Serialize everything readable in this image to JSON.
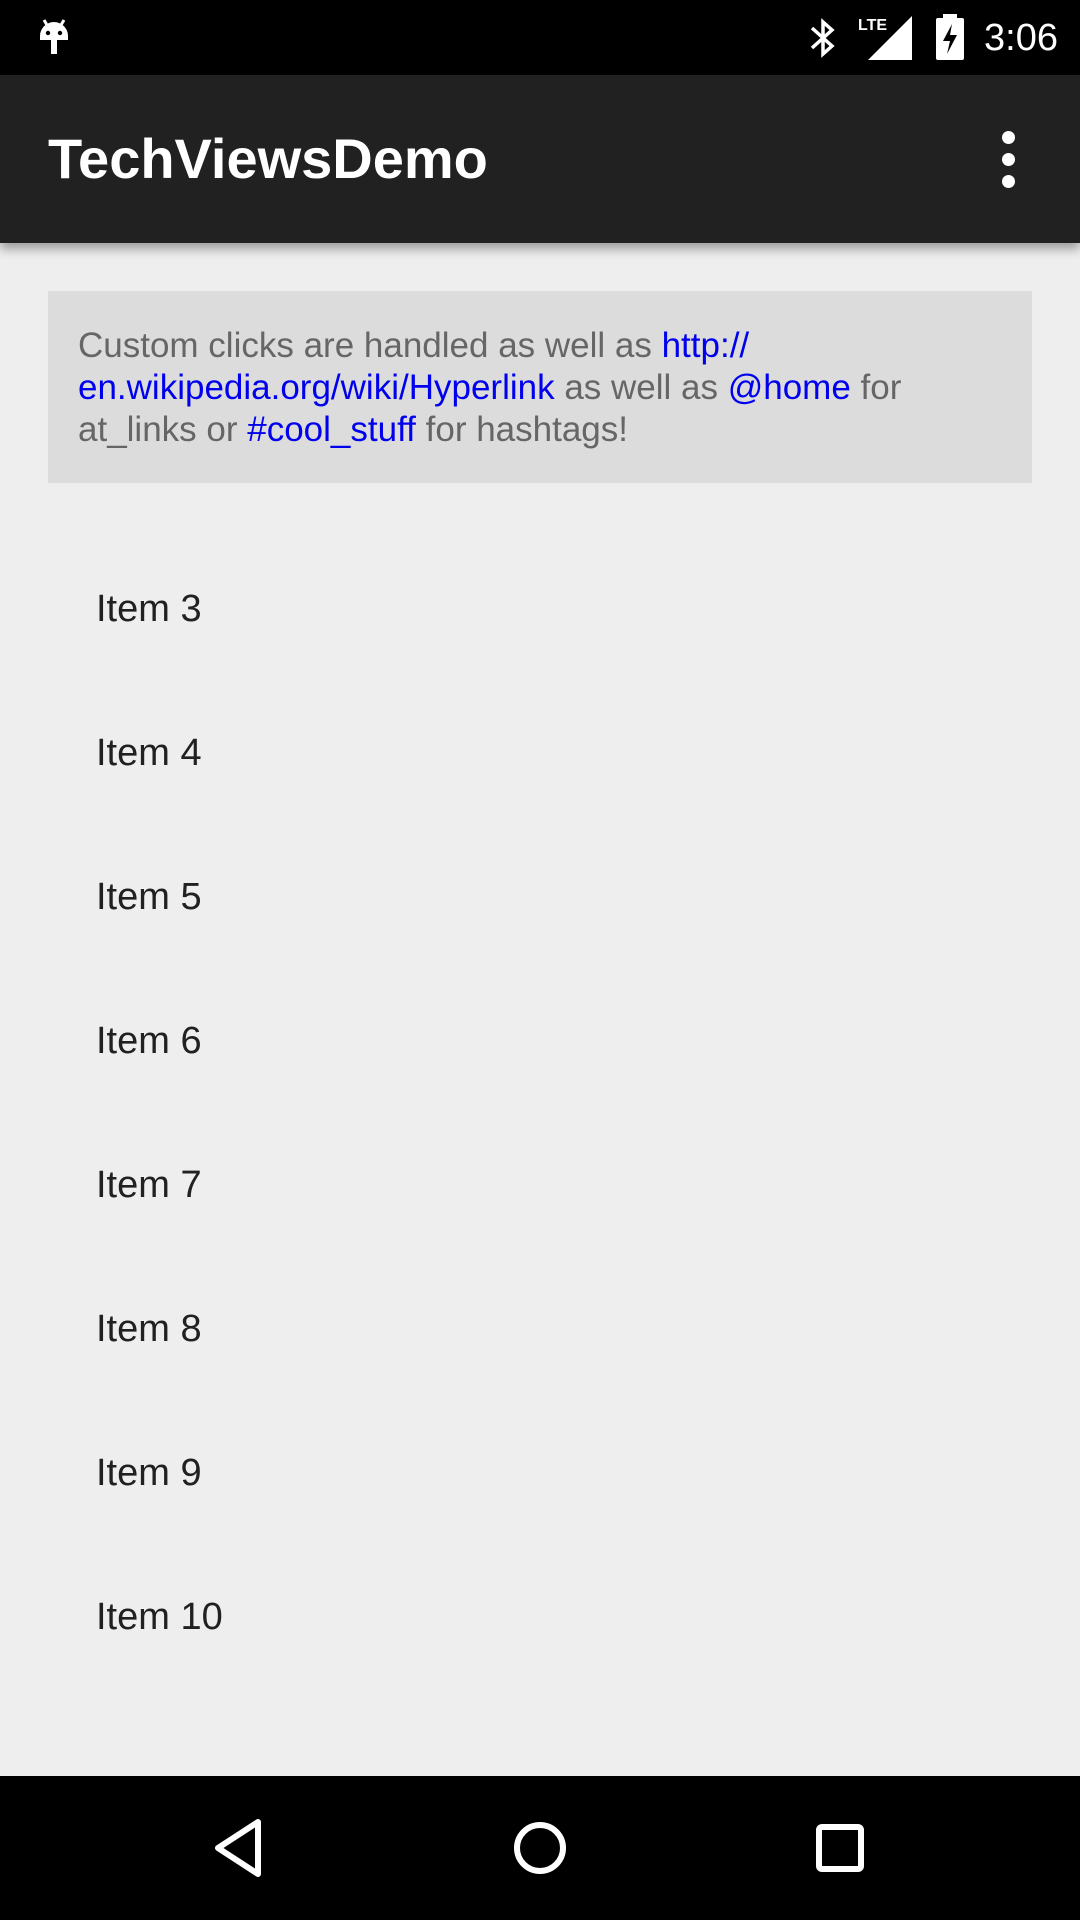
{
  "status_bar": {
    "time": "3:06",
    "network": "LTE",
    "icons": [
      "android-debug-icon",
      "bluetooth-icon",
      "lte-signal-icon",
      "battery-charging-icon"
    ]
  },
  "app_bar": {
    "title": "TechViewsDemo",
    "overflow_icon": "more-vert-icon"
  },
  "info_card": {
    "segments": [
      {
        "text": "Custom clicks are handled as well as ",
        "link": false
      },
      {
        "text": "http://\nen.wikipedia.org/wiki/Hyperlink",
        "link": true
      },
      {
        "text": " as well as ",
        "link": false
      },
      {
        "text": "@home",
        "link": true
      },
      {
        "text": " for at_links or ",
        "link": false
      },
      {
        "text": "#cool_stuff",
        "link": true
      },
      {
        "text": " for hashtags!",
        "link": false
      }
    ]
  },
  "list": {
    "items": [
      "Item 3",
      "Item 4",
      "Item 5",
      "Item 6",
      "Item 7",
      "Item 8",
      "Item 9",
      "Item 10"
    ]
  },
  "nav_bar": {
    "buttons": [
      "back-icon",
      "home-icon",
      "recents-icon"
    ]
  },
  "colors": {
    "background": "#eeeeee",
    "app_bar": "#212121",
    "card": "#dcdcdc",
    "link": "#0000ee",
    "body_text": "#666666"
  }
}
